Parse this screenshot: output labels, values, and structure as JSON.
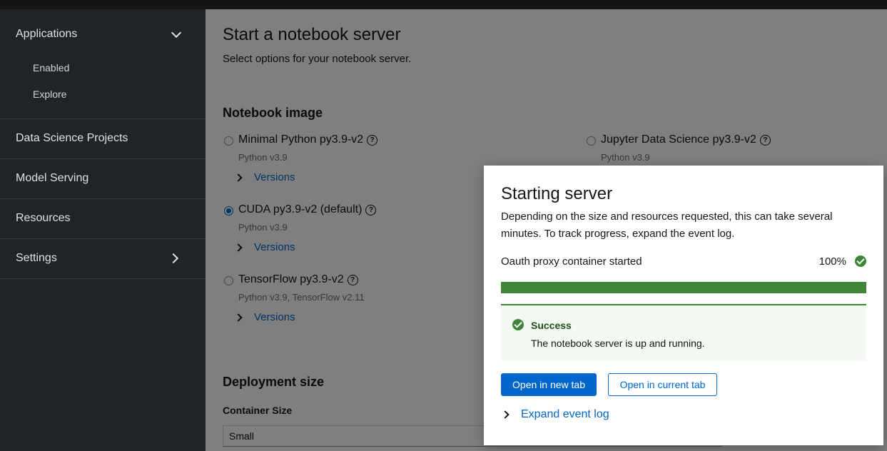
{
  "sidebar": {
    "applications": {
      "label": "Applications",
      "items": [
        {
          "label": "Enabled"
        },
        {
          "label": "Explore"
        }
      ]
    },
    "items": [
      {
        "label": "Data Science Projects"
      },
      {
        "label": "Model Serving"
      },
      {
        "label": "Resources"
      },
      {
        "label": "Settings"
      }
    ]
  },
  "main": {
    "title": "Start a notebook server",
    "subtitle": "Select options for your notebook server.",
    "notebook_image": {
      "heading": "Notebook image",
      "images": [
        {
          "name": "Minimal Python py3.9-v2",
          "desc": "Python v3.9",
          "versions": "Versions",
          "selected": false
        },
        {
          "name": "CUDA py3.9-v2 (default)",
          "desc": "Python v3.9",
          "versions": "Versions",
          "selected": true
        },
        {
          "name": "TensorFlow py3.9-v2",
          "desc": "Python v3.9, TensorFlow v2.11",
          "versions": "Versions",
          "selected": false
        },
        {
          "name": "Jupyter Data Science py3.9-v2",
          "desc": "Python v3.9",
          "selected": false
        }
      ]
    },
    "deployment": {
      "heading": "Deployment size",
      "container_label": "Container Size",
      "container_value": "Small"
    }
  },
  "modal": {
    "title": "Starting server",
    "description": "Depending on the size and resources requested, this can take several minutes. To track progress, expand the event log.",
    "progress_label": "Oauth proxy container started",
    "progress_text": "100%",
    "progress_value": 1.0,
    "alert_title": "Success",
    "alert_body": "The notebook server is up and running.",
    "btn_new_tab": "Open in new tab",
    "btn_current_tab": "Open in current tab",
    "expand_log": "Expand event log"
  },
  "colors": {
    "accent": "#0066cc",
    "success": "#3e8635",
    "sidebar_bg": "#212427"
  }
}
